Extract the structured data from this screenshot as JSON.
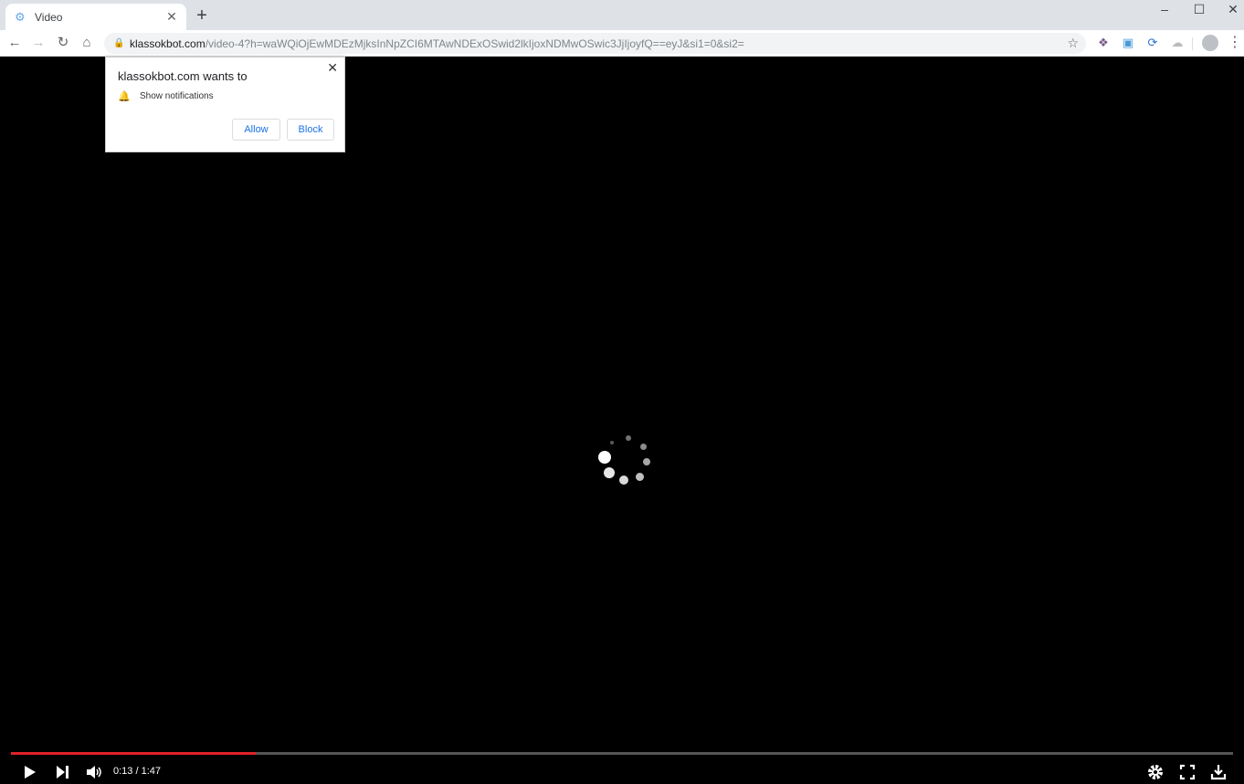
{
  "browser": {
    "tab": {
      "title": "Video",
      "icon": "page-favicon-icon"
    },
    "new_tab_label": "+",
    "url_host": "klassokbot.com",
    "url_path": "/video-4?h=waWQiOjEwMDEzMjksInNpZCI6MTAwNDExOSwid2lkIjoxNDMwOSwic3JjIjoyfQ==eyJ&si1=0&si2=",
    "extensions": [
      "extension-1-icon",
      "extension-2-icon",
      "extension-3-icon",
      "extension-4-icon"
    ]
  },
  "permission_popup": {
    "title": "klassokbot.com wants to",
    "permission": "Show notifications",
    "allow_label": "Allow",
    "block_label": "Block"
  },
  "player": {
    "current_time": "0:13",
    "duration": "1:47",
    "time_display": "0:13 / 1:47",
    "progress_fraction": 0.2,
    "progress_color": "#e0212b",
    "loading": true
  }
}
